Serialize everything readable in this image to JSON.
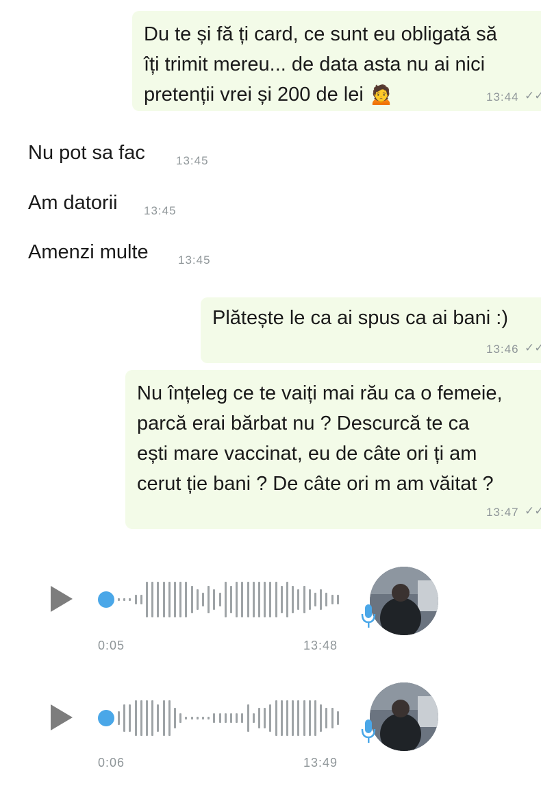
{
  "messages": [
    {
      "dir": "out",
      "lines": [
        "Du te și fă ți card, ce sunt eu obligată să",
        "îți trimit mereu... de data asta nu ai nici",
        "pretenții vrei și 200 de lei 🙍"
      ],
      "time": "13:44"
    },
    {
      "dir": "in",
      "text": "Nu pot sa fac",
      "time": "13:45"
    },
    {
      "dir": "in",
      "text": "Am datorii",
      "time": "13:45"
    },
    {
      "dir": "in",
      "text": "Amenzi multe",
      "time": "13:45"
    },
    {
      "dir": "out",
      "lines": [
        "Plătește le ca ai spus ca ai bani :)"
      ],
      "time": "13:46"
    },
    {
      "dir": "out",
      "lines": [
        "Nu înțeleg ce te vaiți mai rău ca o femeie,",
        "parcă erai bărbat nu ? Descurcă te ca",
        "ești mare vaccinat, eu de câte ori ți am",
        "cerut ție bani ? De câte ori m am văitat ?"
      ],
      "time": "13:47"
    }
  ],
  "voice_messages": [
    {
      "duration": "0:05",
      "time": "13:48",
      "progress": 0
    },
    {
      "duration": "0:06",
      "time": "13:49",
      "progress": 0
    }
  ],
  "icons": {
    "play": "play-icon",
    "mic": "microphone-icon",
    "read": "double-check-icon"
  },
  "colors": {
    "outgoing_bubble": "#f3fbe8",
    "accent": "#4aa7e8",
    "muted": "#8f9699"
  }
}
